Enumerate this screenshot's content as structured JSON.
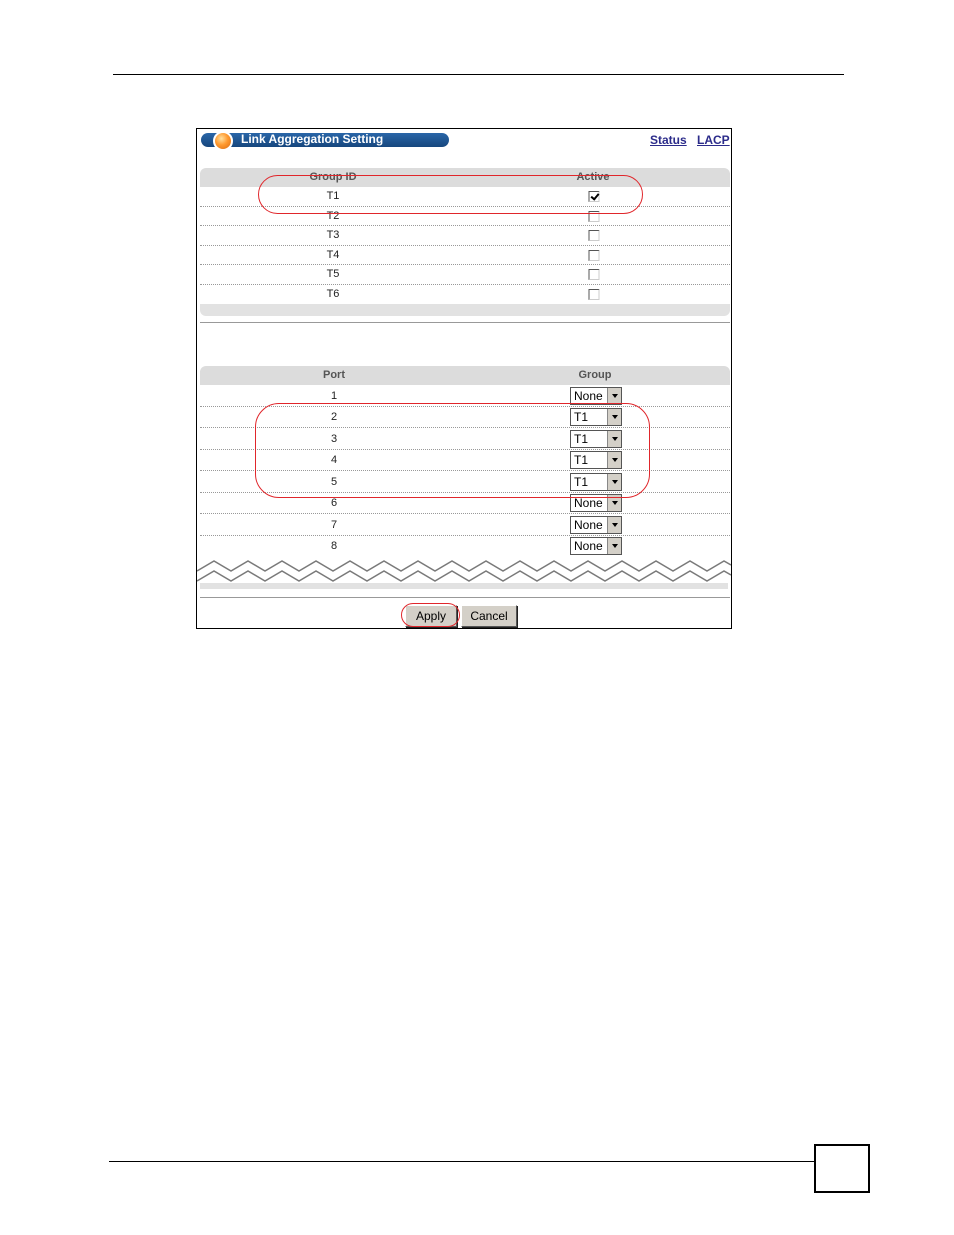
{
  "window": {
    "title": "Link Aggregation Setting",
    "links": {
      "status": "Status",
      "lacp": "LACP"
    }
  },
  "groups_table": {
    "headers": {
      "group_id": "Group ID",
      "active": "Active"
    },
    "rows": [
      {
        "id": "T1",
        "active": true
      },
      {
        "id": "T2",
        "active": false
      },
      {
        "id": "T3",
        "active": false
      },
      {
        "id": "T4",
        "active": false
      },
      {
        "id": "T5",
        "active": false
      },
      {
        "id": "T6",
        "active": false
      }
    ]
  },
  "ports_table": {
    "headers": {
      "port": "Port",
      "group": "Group"
    },
    "rows": [
      {
        "port": "1",
        "group": "None"
      },
      {
        "port": "2",
        "group": "T1"
      },
      {
        "port": "3",
        "group": "T1"
      },
      {
        "port": "4",
        "group": "T1"
      },
      {
        "port": "5",
        "group": "T1"
      },
      {
        "port": "6",
        "group": "None"
      },
      {
        "port": "7",
        "group": "None"
      },
      {
        "port": "8",
        "group": "None"
      }
    ]
  },
  "buttons": {
    "apply": "Apply",
    "cancel": "Cancel"
  },
  "colors": {
    "highlight": "#e0262b",
    "title_bar": "#1f5896",
    "link": "#2b2b8a"
  }
}
